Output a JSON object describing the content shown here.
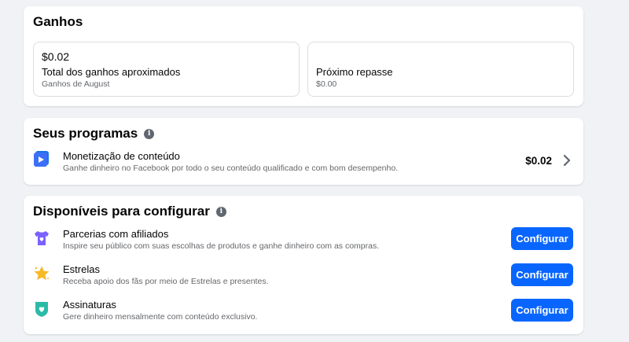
{
  "earnings": {
    "title": "Ganhos",
    "approx": {
      "value": "$0.02",
      "label": "Total dos ganhos aproximados",
      "sub": "Ganhos de August"
    },
    "next_payout": {
      "label": "Próximo repasse",
      "sub": "$0.00"
    }
  },
  "programs": {
    "title": "Seus programas",
    "items": [
      {
        "title": "Monetização de conteúdo",
        "desc": "Ganhe dinheiro no Facebook por todo o seu conteúdo qualificado e com bom desempenho.",
        "amount": "$0.02",
        "icon": "play-video-icon"
      }
    ]
  },
  "available": {
    "title": "Disponíveis para configurar",
    "items": [
      {
        "title": "Parcerias com afiliados",
        "desc": "Inspire seu público com suas escolhas de produtos e ganhe dinheiro com as compras.",
        "button": "Configurar",
        "icon": "shirt-heart-icon"
      },
      {
        "title": "Estrelas",
        "desc": "Receba apoio dos fãs por meio de Estrelas e presentes.",
        "button": "Configurar",
        "icon": "star-icon"
      },
      {
        "title": "Assinaturas",
        "desc": "Gere dinheiro mensalmente com conteúdo exclusivo.",
        "button": "Configurar",
        "icon": "shield-heart-icon"
      }
    ]
  },
  "colors": {
    "accent": "#0866ff",
    "background": "#f0f2f5",
    "card": "#ffffff",
    "secondary_text": "#65676b"
  }
}
